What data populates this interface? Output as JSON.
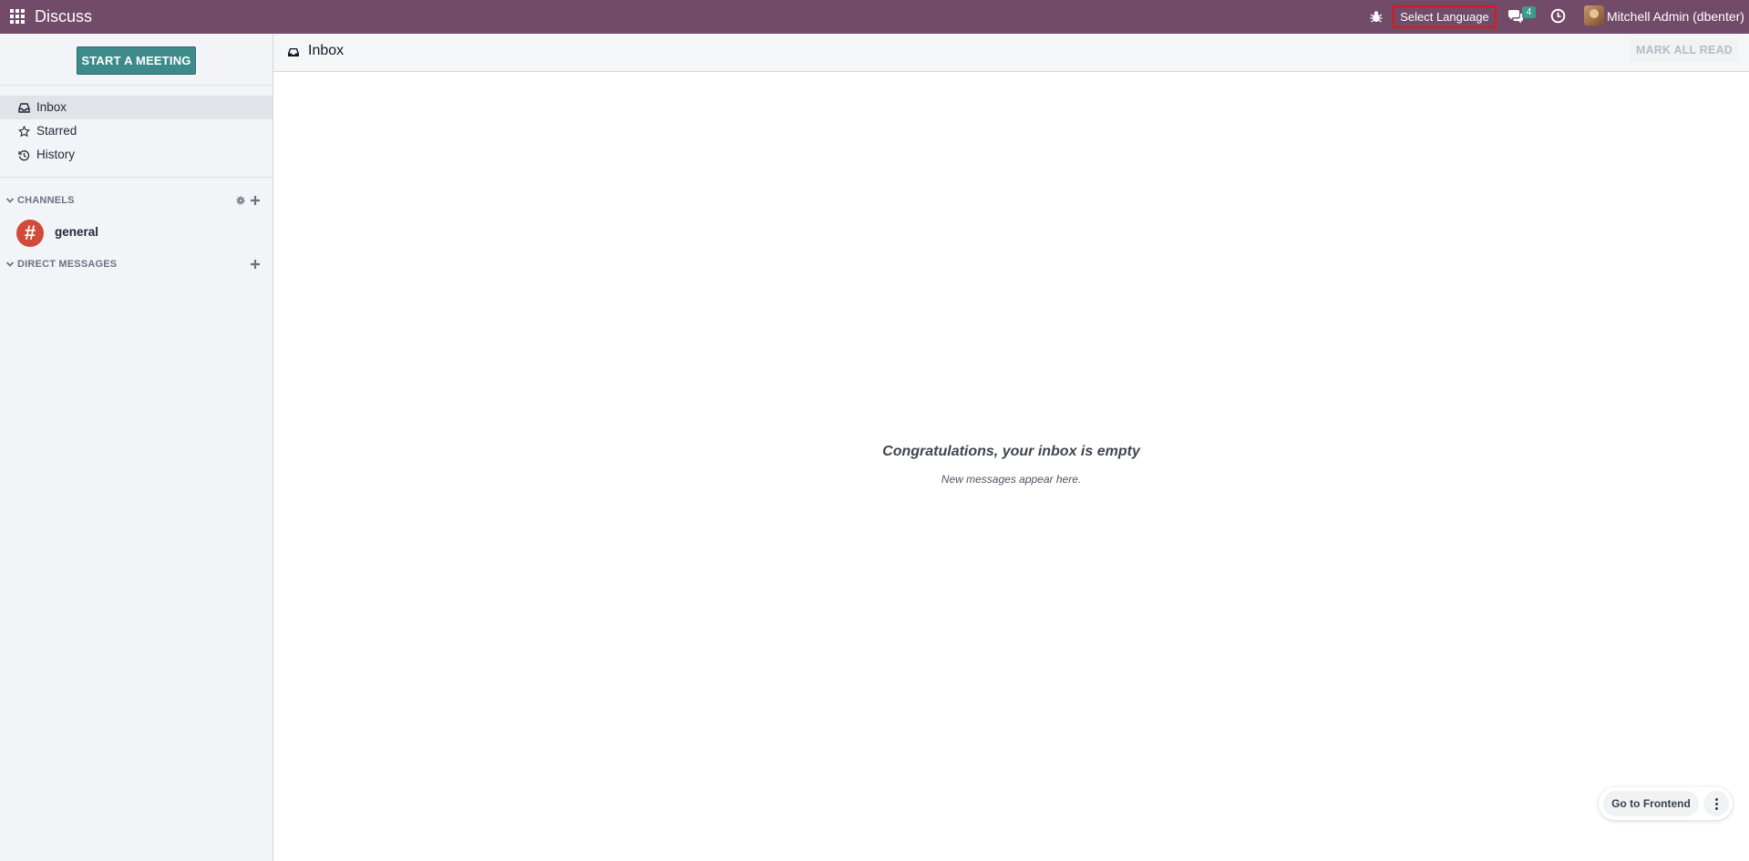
{
  "navbar": {
    "app_title": "Discuss",
    "language_label": "Select Language",
    "chat_count": "4",
    "user_name": "Mitchell Admin (dbenter)"
  },
  "sidebar": {
    "start_meeting_label": "START A MEETING",
    "mailboxes": [
      {
        "label": "Inbox",
        "icon": "inbox-icon",
        "active": true
      },
      {
        "label": "Starred",
        "icon": "star-icon",
        "active": false
      },
      {
        "label": "History",
        "icon": "history-icon",
        "active": false
      }
    ],
    "channels_header": "CHANNELS",
    "channels": [
      {
        "name": "general",
        "avatar_symbol": "#",
        "avatar_color": "#d24a3a"
      }
    ],
    "direct_messages_header": "DIRECT MESSAGES"
  },
  "main": {
    "title": "Inbox",
    "mark_all_read_label": "MARK ALL READ",
    "empty_title": "Congratulations, your inbox is empty",
    "empty_subtitle": "New messages appear here."
  },
  "floating": {
    "frontend_label": "Go to Frontend"
  },
  "colors": {
    "navbar": "#714b67",
    "primary_button": "#3e8a8a",
    "channel_avatar": "#d24a3a",
    "badge": "#3a9b8f"
  }
}
